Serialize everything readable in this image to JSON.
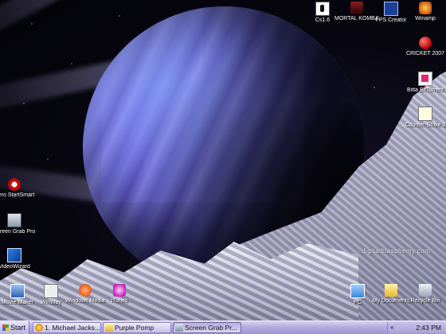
{
  "desktop": {
    "watermark": "digitalblasphemy.com",
    "icons": [
      {
        "label": "Cs1.6",
        "glyph": "counter-strike-icon"
      },
      {
        "label": "MORTAL KOMBAT 4",
        "glyph": "mortal-kombat-icon"
      },
      {
        "label": "FPS Creator",
        "glyph": "fps-creator-icon"
      },
      {
        "label": "Winamp",
        "glyph": "winamp-icon"
      },
      {
        "label": "CRICKET 2007",
        "glyph": "cricket-icon"
      },
      {
        "label": "Bitta BitTorrent",
        "glyph": "bittorrent-icon"
      },
      {
        "label": "Counter-Strike 2",
        "glyph": "counter-strike-icon"
      },
      {
        "label": "Nero StartSmart",
        "glyph": "nero-icon"
      },
      {
        "label": "Screen Grab Pro",
        "glyph": "screen-grab-icon"
      },
      {
        "label": "VideoWizard",
        "glyph": "video-wizard-icon"
      },
      {
        "label": "Movie Maker",
        "glyph": "movie-maker-icon"
      },
      {
        "label": "WinWay",
        "glyph": "winway-icon"
      },
      {
        "label": "Windows Media",
        "glyph": "media-player-icon"
      },
      {
        "label": "iTunes",
        "glyph": "itunes-icon"
      },
      {
        "label": "PC",
        "glyph": "my-computer-icon"
      },
      {
        "label": "My Documents",
        "glyph": "my-documents-icon"
      },
      {
        "label": "Recycle Bin",
        "glyph": "recycle-bin-icon"
      }
    ]
  },
  "taskbar": {
    "start_label": "Start",
    "tasks": [
      {
        "label": "1. Michael Jacks...",
        "icon": "music-player-icon",
        "active": false
      },
      {
        "label": "Purple Pomp",
        "icon": "folder-icon",
        "active": false
      },
      {
        "label": "Screen Grab Pr...",
        "icon": "screen-grab-icon",
        "active": true
      }
    ],
    "tray_chevron": "«",
    "clock": "2:43 PM"
  }
}
